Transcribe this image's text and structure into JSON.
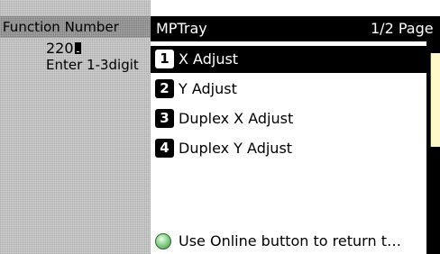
{
  "left_panel": {
    "header": "Function Number",
    "value": "220",
    "hint": "Enter 1-3digit"
  },
  "dialog": {
    "title": "MPTray",
    "page": "1/2 Page",
    "items": [
      {
        "num": "1",
        "label": "X Adjust",
        "selected": true
      },
      {
        "num": "2",
        "label": "Y Adjust",
        "selected": false
      },
      {
        "num": "3",
        "label": "Duplex X Adjust",
        "selected": false
      },
      {
        "num": "4",
        "label": "Duplex Y Adjust",
        "selected": false
      }
    ],
    "footer_text": "Use Online button to return t…",
    "footer_icon": "online-button-icon",
    "scrollbar_thumb_color": "#fff8c8"
  }
}
